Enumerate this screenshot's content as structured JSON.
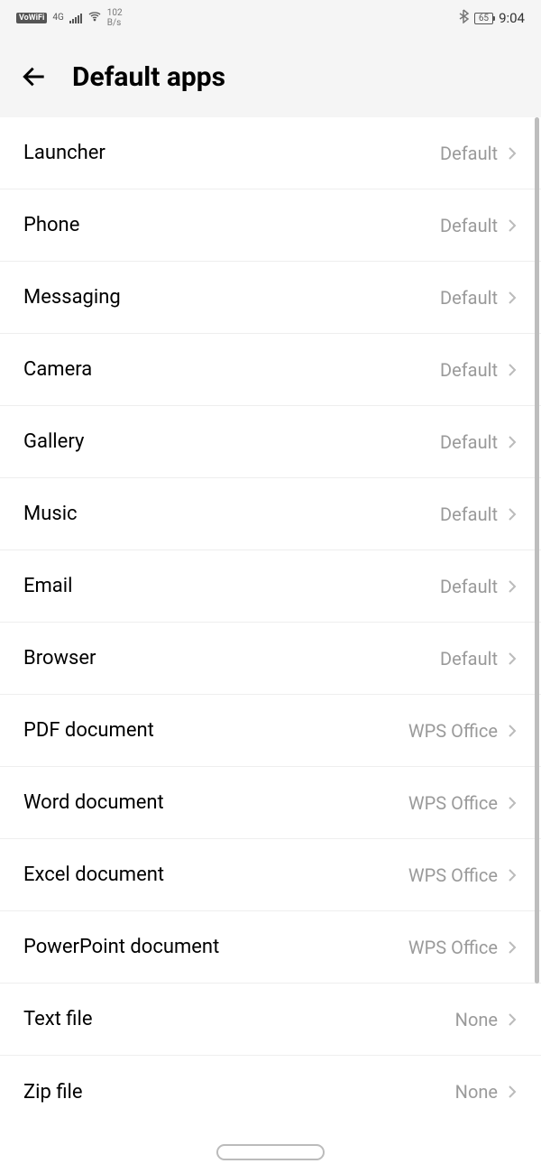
{
  "statusbar": {
    "vowifi": "VoWiFi",
    "network_type": "4G",
    "speed_value": "102",
    "speed_unit": "B/s",
    "battery": "65",
    "time": "9:04"
  },
  "header": {
    "title": "Default apps"
  },
  "items": [
    {
      "label": "Launcher",
      "value": "Default"
    },
    {
      "label": "Phone",
      "value": "Default"
    },
    {
      "label": "Messaging",
      "value": "Default"
    },
    {
      "label": "Camera",
      "value": "Default"
    },
    {
      "label": "Gallery",
      "value": "Default"
    },
    {
      "label": "Music",
      "value": "Default"
    },
    {
      "label": "Email",
      "value": "Default"
    },
    {
      "label": "Browser",
      "value": "Default"
    },
    {
      "label": "PDF document",
      "value": "WPS Office"
    },
    {
      "label": "Word document",
      "value": "WPS Office"
    },
    {
      "label": "Excel document",
      "value": "WPS Office"
    },
    {
      "label": "PowerPoint document",
      "value": "WPS Office"
    },
    {
      "label": "Text file",
      "value": "None"
    },
    {
      "label": "Zip file",
      "value": "None"
    }
  ]
}
